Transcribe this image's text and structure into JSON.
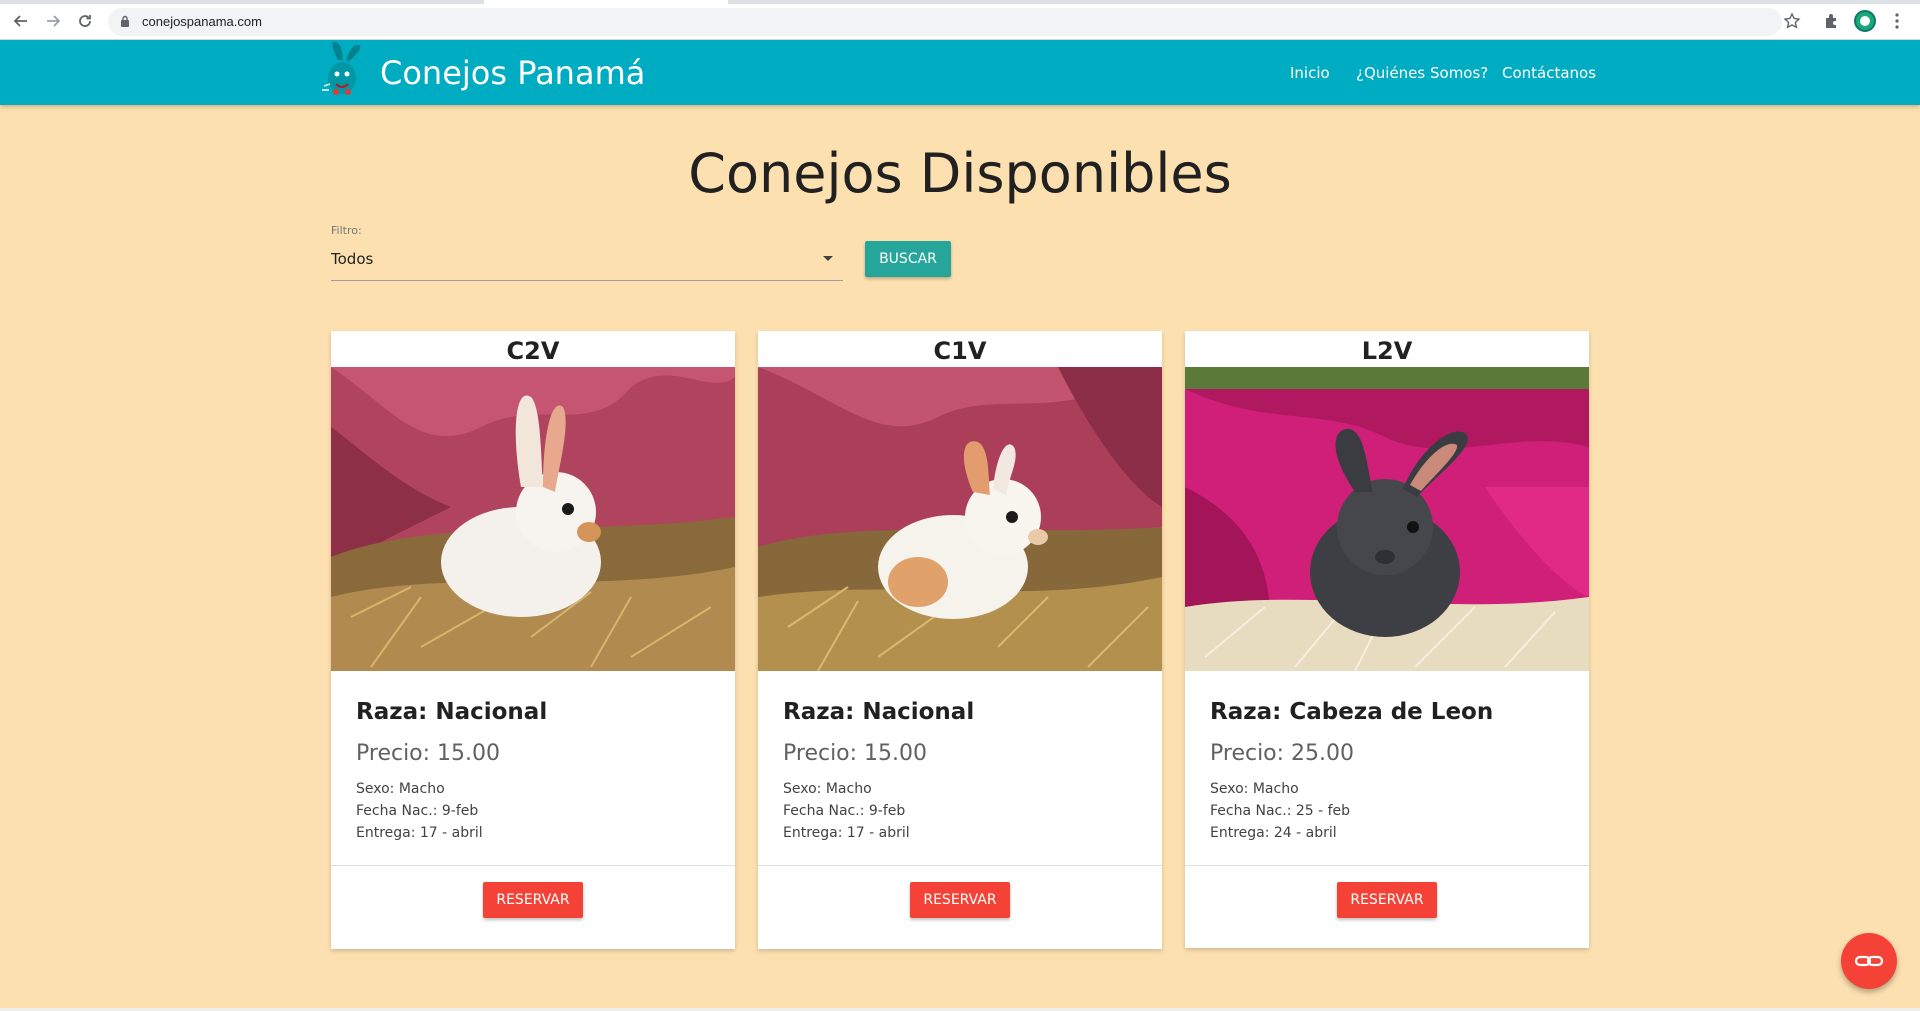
{
  "browser": {
    "url": "conejospanama.com",
    "icons": [
      "back-icon",
      "forward-icon",
      "reload-icon",
      "lock-icon",
      "star-icon",
      "extensions-icon",
      "profile-avatar",
      "kebab-menu-icon"
    ]
  },
  "header": {
    "brand": "Conejos Panamá",
    "nav": [
      {
        "label": "Inicio"
      },
      {
        "label": "¿Quiénes Somos?"
      },
      {
        "label": "Contáctanos"
      }
    ],
    "color": "#00acc1"
  },
  "main": {
    "title": "Conejos Disponibles",
    "filter": {
      "label": "Filtro:",
      "value": "Todos"
    },
    "search_button": "BUSCAR",
    "background": "#fde0b0"
  },
  "cards": [
    {
      "code": "C2V",
      "raza": "Raza: Nacional",
      "precio": "Precio: 15.00",
      "sexo": "Sexo: Macho",
      "fecha": "Fecha Nac.: 9-feb",
      "entrega": "Entrega: 17 - abril",
      "button": "RESERVAR",
      "photo": "white-rabbit-on-hay"
    },
    {
      "code": "C1V",
      "raza": "Raza: Nacional",
      "precio": "Precio: 15.00",
      "sexo": "Sexo: Macho",
      "fecha": "Fecha Nac.: 9-feb",
      "entrega": "Entrega: 17 - abril",
      "button": "RESERVAR",
      "photo": "white-orange-rabbit-on-hay"
    },
    {
      "code": "L2V",
      "raza": "Raza: Cabeza de Leon",
      "precio": "Precio: 25.00",
      "sexo": "Sexo: Macho",
      "fecha": "Fecha Nac.: 25 - feb",
      "entrega": "Entrega: 24 - abril",
      "button": "RESERVAR",
      "photo": "gray-lionhead-rabbit-on-pink-blanket"
    }
  ],
  "fab": {
    "icon": "link-icon",
    "color": "#f44336"
  }
}
